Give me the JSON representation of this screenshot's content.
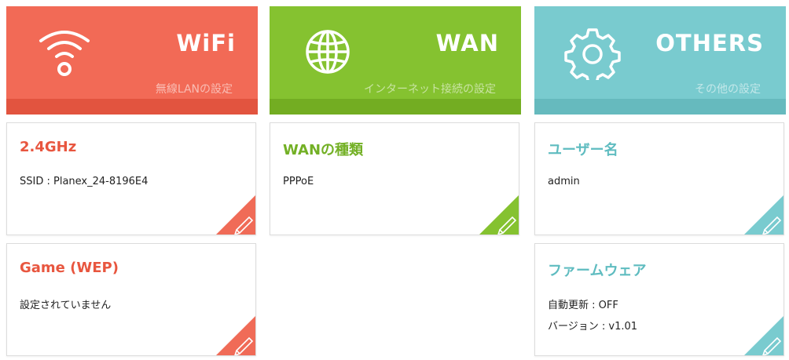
{
  "headers": [
    {
      "id": "wifi",
      "title": "WiFi",
      "subtitle": "無線LANの設定",
      "icon": "wifi-icon",
      "color": "#f26a56"
    },
    {
      "id": "wan",
      "title": "WAN",
      "subtitle": "インターネット接続の設定",
      "icon": "globe-icon",
      "color": "#85c230"
    },
    {
      "id": "others",
      "title": "OTHERS",
      "subtitle": "その他の設定",
      "icon": "gear-icon",
      "color": "#79cbcf"
    }
  ],
  "cards": {
    "wifi_24": {
      "title": "2.4GHz",
      "lines": [
        "SSID : Planex_24-8196E4"
      ],
      "edit_icon": "pencil-icon"
    },
    "wifi_game": {
      "title": "Game (WEP)",
      "lines": [
        "設定されていません"
      ],
      "edit_icon": "pencil-icon"
    },
    "wan_type": {
      "title": "WANの種類",
      "lines": [
        "PPPoE"
      ],
      "edit_icon": "pencil-icon"
    },
    "others_user": {
      "title": "ユーザー名",
      "lines": [
        "admin"
      ],
      "edit_icon": "pencil-icon"
    },
    "others_fw": {
      "title": "ファームウェア",
      "lines": [
        "自動更新 : OFF",
        "バージョン : v1.01"
      ],
      "edit_icon": "pencil-icon"
    }
  }
}
